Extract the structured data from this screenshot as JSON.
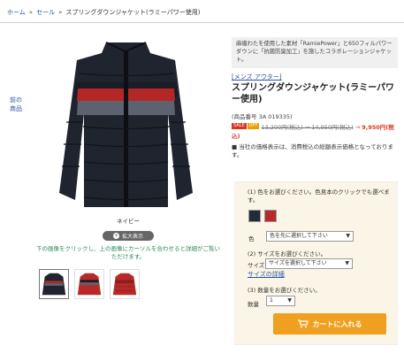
{
  "breadcrumb": {
    "home": "ホーム",
    "sale": "セール",
    "current": "スプリングダウンジャケット(ラミーパワー使用)"
  },
  "nav": {
    "prev_label": "前の商品"
  },
  "image": {
    "color_name": "ネイビー",
    "zoom_label": "拡大表示",
    "instruction": "下の画像をクリックし、上の画像にカーソルを合わせると詳細がご覧いただけます。"
  },
  "thumbnails": [
    "navy",
    "red",
    "red-back"
  ],
  "product": {
    "description": "麻繊わたを使用した素材「RamiePower」と650フィルパワーダウンに「抗菌防臭加工」を施したコラボレーションジャケット。",
    "category": "[メンズ アウター]",
    "title": "スプリングダウンジャケット(ラミーパワー使用)",
    "product_no": "(商品番号 3A 019335)",
    "badges": [
      "SALE",
      "OFF"
    ],
    "old_price": "13,200円(税込) → 14,950円(税込)",
    "arrow": " → ",
    "new_price": "9,950円(税込)",
    "note": "■ 当社の価格表示は、消費税込の総額表示価格となっております。"
  },
  "options": {
    "step1": "(1) 色をお選びください。色見本のクリックでも選べます。",
    "colors": [
      {
        "name": "navy",
        "hex": "#232b3b"
      },
      {
        "name": "red",
        "hex": "#b82a2a"
      }
    ],
    "color_label": "色",
    "color_select": "色を先に選択して下さい",
    "step2": "(2) サイズをお選びください。",
    "size_label": "サイズ",
    "size_select": "サイズを選択して下さい",
    "size_detail": "サイズの詳細",
    "step3": "(3) 数量をお選びください。",
    "qty_label": "数量",
    "qty_value": "1",
    "cart_label": "カートに入れる"
  }
}
